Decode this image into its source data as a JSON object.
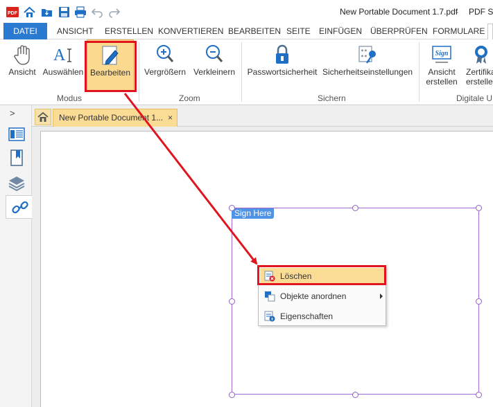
{
  "window": {
    "title": "New Portable Document 1.7.pdf",
    "separator": "-",
    "app_name": "PDF Su"
  },
  "quick_access": [
    {
      "icon": "pdf-logo-icon"
    },
    {
      "icon": "home-icon"
    },
    {
      "icon": "open-folder-icon"
    },
    {
      "icon": "save-icon"
    },
    {
      "icon": "print-icon"
    },
    {
      "icon": "undo-icon"
    },
    {
      "icon": "redo-icon"
    }
  ],
  "menu": {
    "tabs": [
      "DATEI",
      "ANSICHT",
      "ERSTELLEN",
      "KONVERTIEREN",
      "BEARBEITEN",
      "SEITE",
      "EINFÜGEN",
      "ÜBERPRÜFEN",
      "FORMULARE"
    ],
    "active": "DATEI"
  },
  "ribbon": {
    "buttons": {
      "ansicht": {
        "label": "Ansicht",
        "icon": "hand-icon"
      },
      "auswaehlen": {
        "label": "Auswählen",
        "icon": "text-select-icon"
      },
      "bearbeiten": {
        "label": "Bearbeiten",
        "icon": "edit-pencil-icon"
      },
      "vergroessern": {
        "label": "Vergrößern",
        "icon": "zoom-in-icon"
      },
      "verkleinern": {
        "label": "Verkleinern",
        "icon": "zoom-out-icon"
      },
      "passwort": {
        "label": "Passwortsicherheit",
        "icon": "lock-icon"
      },
      "sicherheit": {
        "label": "Sicherheitseinstellungen",
        "icon": "security-key-icon"
      },
      "ansicht_erstellen": {
        "label": "Ansicht",
        "label2": "erstellen",
        "icon": "sign-icon"
      },
      "zertifikat": {
        "label": "Zertifika",
        "label2": "erstelle",
        "icon": "certificate-icon"
      }
    },
    "groups": {
      "modus": "Modus",
      "zoom": "Zoom",
      "sichern": "Sichern",
      "digitale": "Digitale U"
    },
    "selected": "Bearbeiten"
  },
  "sidepanel": {
    "toggle": ">",
    "items": [
      {
        "icon": "page-thumbnails-icon"
      },
      {
        "icon": "bookmark-icon"
      },
      {
        "icon": "layers-icon"
      },
      {
        "icon": "link-icon",
        "active": true
      }
    ]
  },
  "document_tabs": {
    "home_icon": "home-icon",
    "tab_label": "New Portable Document 1...",
    "close": "×"
  },
  "signature_field": {
    "label": "Sign Here"
  },
  "context_menu": {
    "items": [
      {
        "label": "Löschen",
        "icon": "delete-icon",
        "highlighted": true
      },
      {
        "label": "Objekte anordnen",
        "icon": "arrange-icon",
        "submenu": true
      },
      {
        "label": "Eigenschaften",
        "icon": "properties-icon"
      }
    ]
  },
  "colors": {
    "accent": "#2b7ad1",
    "selection": "#fbd98f",
    "annotation_red": "#e0141e",
    "field_border": "#a56bd3"
  }
}
